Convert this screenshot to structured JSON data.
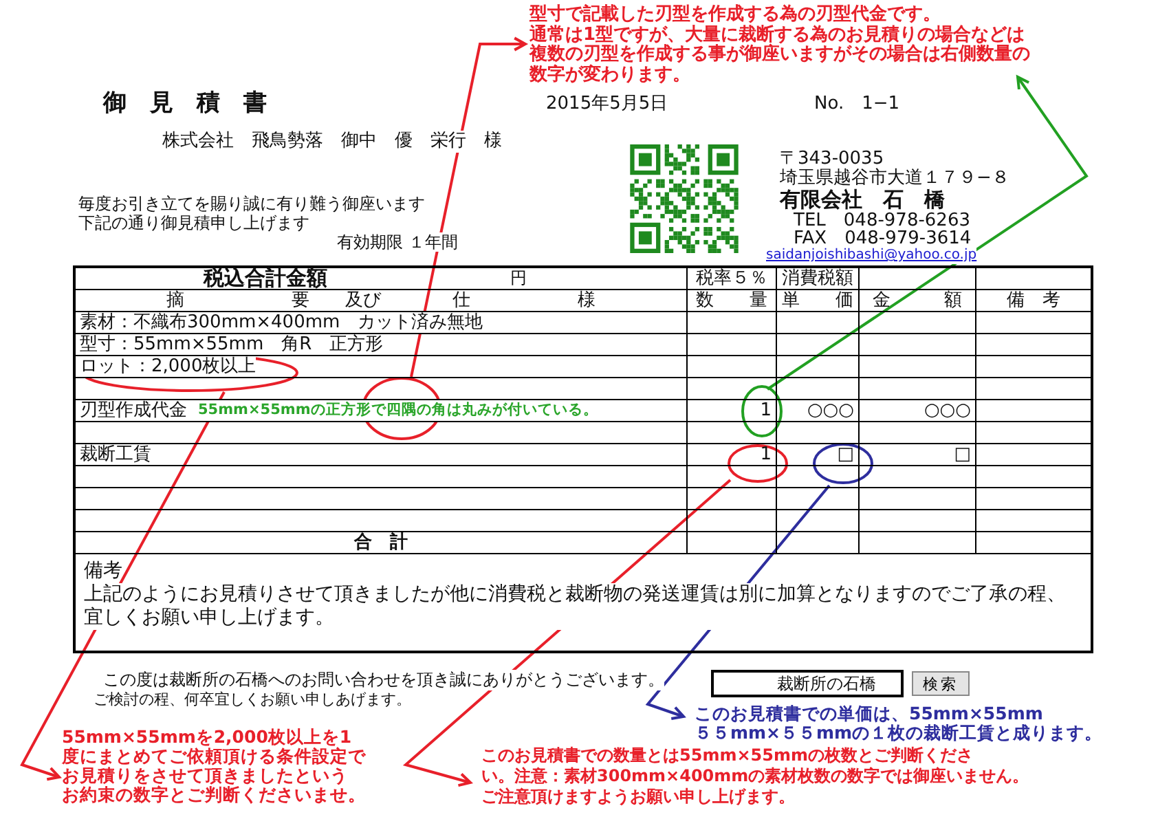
{
  "document": {
    "title": "御　見　積　書",
    "date": "2015年5月5日",
    "number": "No.　1−1",
    "recipient": "株式会社　飛鳥勢落　御中　優　栄行　様",
    "greeting": [
      "毎度お引き立てを賜り誠に有り難う御座います",
      "下記の通り御見積申し上げます"
    ],
    "validity": "有効期限 １年間"
  },
  "sender": {
    "postal": "〒343-0035",
    "address": "埼玉県越谷市大道１７９−８",
    "company": "有限会社　石　橋",
    "tel": "TEL　048-978-6263",
    "fax": "FAX　048-979-3614",
    "email": "saidanjoishibashi@yahoo.co.jp"
  },
  "table": {
    "total_label": "税込合計金額",
    "yen": "円",
    "tax_rate": "税率５％",
    "tax_amount": "消費税額",
    "columns": [
      "摘　　　　　　要　　及び　　　　仕　　　　　　様",
      "数　　量",
      "単　　価",
      "金　　　額",
      "備　考"
    ],
    "rows": [
      {
        "description": "素材：不織布300mm×400mm　カット済み無地"
      },
      {
        "description": "型寸：55mm×55mm　角R　正方形"
      },
      {
        "description": "ロット：2,000枚以上"
      },
      {},
      {
        "description": "刃型作成代金",
        "annotation": "55mm×55mmの正方形で四隅の角は丸みが付いている。",
        "quantity": "1",
        "unit_price": "○○○",
        "amount": "○○○"
      },
      {},
      {
        "description": "裁断工賃",
        "quantity": "1",
        "unit_price": "□",
        "amount": "□"
      },
      {},
      {},
      {}
    ],
    "sum_label": "合　計",
    "remarks_label": "備考",
    "remarks": "上記のようにお見積りさせて頂きましたが他に消費税と裁断物の発送運賃は別に加算となりますのでご了承の程、宜しくお願い申し上げます。"
  },
  "footer": {
    "thanks": "この度は裁断所の石橋へのお問い合わせを頂き誠にありがとうございます。",
    "closing": "ご検討の程、何卒宜しくお願い申しあげます。",
    "search_value": "裁断所の石橋",
    "search_button": "検索"
  },
  "notes": [
    {
      "color": "#e8202a",
      "lines": [
        "型寸で記載した刃型を作成する為の刃型代金です。",
        "通常は1型ですが、大量に裁断する為のお見積りの場合などは",
        "複数の刃型を作成する事が御座いますがその場合は右側数量の",
        "数字が変わります。"
      ]
    },
    {
      "color": "#2e2e9e",
      "lines": [
        "このお見積書での単価は、55mm×55mm",
        "５５mm×５５mmの１枚の裁断工賃と成ります。"
      ]
    },
    {
      "color": "#e8202a",
      "lines": [
        "55mm×55mmを2,000枚以上を1",
        "度にまとめてご依頼頂ける条件設定で",
        "お見積りをさせて頂きましたという",
        "お約束の数字とご判断くださいませ。"
      ]
    },
    {
      "color": "#e8202a",
      "lines": [
        "このお見積書での数量とは55mm×55mmの枚数とご判断くださ",
        "い。注意：素材300mm×400mmの素材枚数の数字では御座いません。",
        "ご注意頂けますようお願い申し上げます。"
      ]
    }
  ]
}
